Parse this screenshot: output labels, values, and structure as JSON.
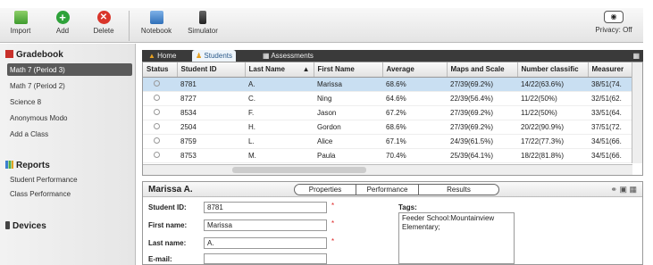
{
  "toolbar": {
    "import": "Import",
    "add": "Add",
    "delete": "Delete",
    "notebook": "Notebook",
    "simulator": "Simulator",
    "privacy": "Privacy: Off"
  },
  "sidebar": {
    "gradebook_title": "Gradebook",
    "classes": [
      "Math 7 (Period 3)",
      "Math 7 (Period 2)",
      "Science 8",
      "Anonymous Modo",
      "Add a Class"
    ],
    "reports_title": "Reports",
    "reports": [
      "Student Performance",
      "Class Performance"
    ],
    "devices_title": "Devices"
  },
  "tabs": [
    "Home",
    "Students",
    "Assessments"
  ],
  "table": {
    "headers": [
      "Status",
      "Student ID",
      "Last Name",
      "First Name",
      "Average",
      "Maps and Scale",
      "Number classific",
      "Measurer"
    ],
    "rows": [
      [
        "8781",
        "A.",
        "Marissa",
        "68.6%",
        "27/39(69.2%)",
        "14/22(63.6%)",
        "38/51(74."
      ],
      [
        "8727",
        "C.",
        "Ning",
        "64.6%",
        "22/39(56.4%)",
        "11/22(50%)",
        "32/51(62."
      ],
      [
        "8534",
        "F.",
        "Jason",
        "67.2%",
        "27/39(69.2%)",
        "11/22(50%)",
        "33/51(64."
      ],
      [
        "2504",
        "H.",
        "Gordon",
        "68.6%",
        "27/39(69.2%)",
        "20/22(90.9%)",
        "37/51(72."
      ],
      [
        "8759",
        "L.",
        "Alice",
        "67.1%",
        "24/39(61.5%)",
        "17/22(77.3%)",
        "34/51(66."
      ],
      [
        "8753",
        "M.",
        "Paula",
        "70.4%",
        "25/39(64.1%)",
        "18/22(81.8%)",
        "34/51(66."
      ]
    ]
  },
  "detail": {
    "name": "Marissa A.",
    "tabs": [
      "Properties",
      "Performance",
      "Results"
    ],
    "student_id_label": "Student ID:",
    "student_id": "8781",
    "first_name_label": "First name:",
    "first_name": "Marissa",
    "last_name_label": "Last name:",
    "last_name": "A.",
    "email_label": "E-mail:",
    "email": "",
    "tags_label": "Tags:",
    "tags": "Feeder School:Mountainview Elementary;"
  }
}
